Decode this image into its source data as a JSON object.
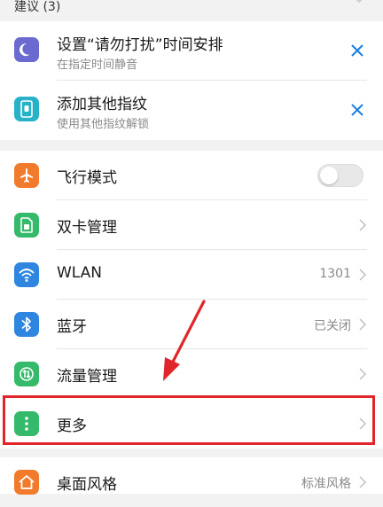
{
  "suggestions": {
    "header": "建议 (3)",
    "items": [
      {
        "title": "设置“请勿打扰”时间安排",
        "subtitle": "在指定时间静音",
        "icon": "moon-icon",
        "icon_color": "#6a6ad0"
      },
      {
        "title": "添加其他指纹",
        "subtitle": "使用其他指纹解锁",
        "icon": "fingerprint-phone-icon",
        "icon_color": "#27b2c9"
      }
    ]
  },
  "settings": {
    "items": [
      {
        "label": "飞行模式",
        "icon": "airplane-icon",
        "icon_color": "#f27a2c",
        "toggle": "off"
      },
      {
        "label": "双卡管理",
        "icon": "sim-card-icon",
        "icon_color": "#35b96a"
      },
      {
        "label": "WLAN",
        "value": "1301",
        "icon": "wifi-icon",
        "icon_color": "#2f86e0"
      },
      {
        "label": "蓝牙",
        "value": "已关闭",
        "icon": "bluetooth-icon",
        "icon_color": "#2f86e0"
      },
      {
        "label": "流量管理",
        "icon": "data-usage-icon",
        "icon_color": "#35b96a"
      },
      {
        "label": "更多",
        "icon": "more-dots-icon",
        "icon_color": "#35b96a"
      },
      {
        "label": "桌面风格",
        "value": "标准风格",
        "icon": "home-icon",
        "icon_color": "#f27a2c"
      }
    ]
  },
  "colors": {
    "highlight": "#e0262a",
    "close_x": "#1a7fe0"
  }
}
